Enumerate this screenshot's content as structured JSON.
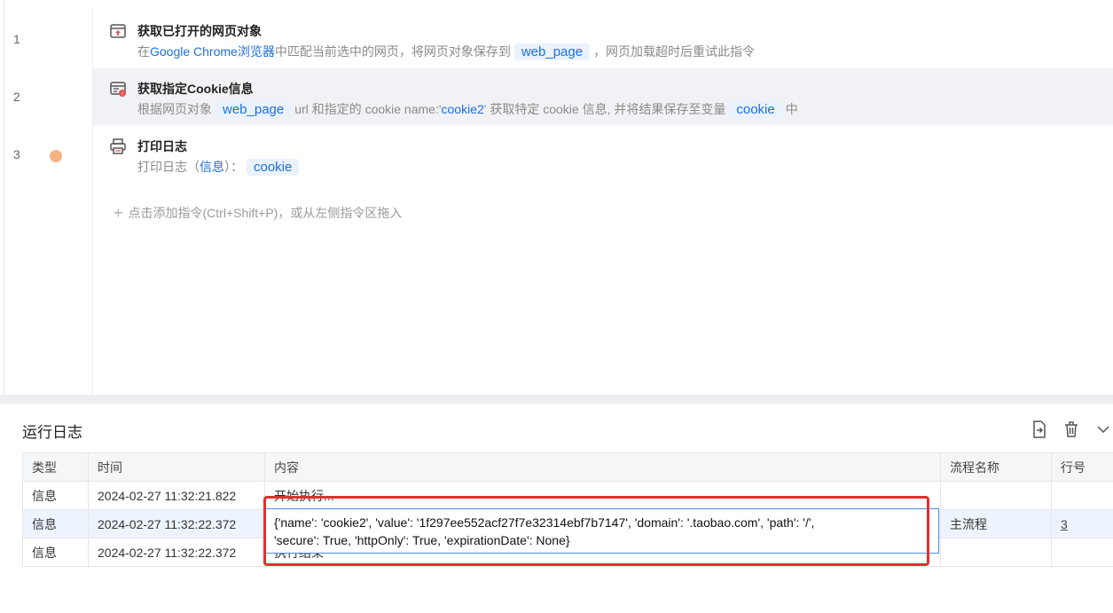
{
  "editor": {
    "rows": [
      {
        "num": "1",
        "title": "获取已打开的网页对象",
        "desc_pre": "在",
        "desc_blue": "Google Chrome浏览器",
        "desc_mid": "中匹配当前选中的网页，将网页对象保存到",
        "tag": "web_page",
        "desc_post": "，网页加载超时后重试此指令"
      },
      {
        "num": "2",
        "title": "获取指定Cookie信息",
        "desc_pre": "根据网页对象",
        "tag": "web_page",
        "desc_mid": "url 和指定的 cookie name:'",
        "desc_blue": "cookie2",
        "desc_mid2": "' 获取特定 cookie 信息, 并将结果保存至变量",
        "tag2": "cookie",
        "desc_post": "中"
      },
      {
        "num": "3",
        "title": "打印日志",
        "desc_pre": "打印日志（",
        "desc_blue": "信息",
        "desc_mid": "）：",
        "tag": "cookie"
      }
    ],
    "add_hint": "点击添加指令(Ctrl+Shift+P)，或从左侧指令区拖入"
  },
  "log": {
    "title": "运行日志",
    "tool_icons": [
      "export-icon",
      "trash-icon",
      "chevron-down-icon"
    ],
    "columns": [
      "类型",
      "时间",
      "内容",
      "流程名称",
      "行号"
    ],
    "rows": [
      {
        "type": "信息",
        "time": "2024-02-27 11:32:21.822",
        "content": "开始执行...",
        "flow": "",
        "line": ""
      },
      {
        "type": "信息",
        "time": "2024-02-27 11:32:22.372",
        "content": "",
        "flow": "主流程",
        "line": "3"
      },
      {
        "type": "信息",
        "time": "2024-02-27 11:32:22.372",
        "content": "执行结束",
        "flow": "",
        "line": ""
      }
    ],
    "expanded_content_line1": "{'name': 'cookie2', 'value': '1f297ee552acf27f7e32314ebf7b7147', 'domain': '.taobao.com', 'path': '/',",
    "expanded_content_line2": "'secure': True, 'httpOnly': True, 'expirationDate': None}"
  },
  "colors": {
    "accent": "#1d6fe0",
    "highlight_border": "#e52f2f",
    "breakpoint": "#f6b384"
  }
}
